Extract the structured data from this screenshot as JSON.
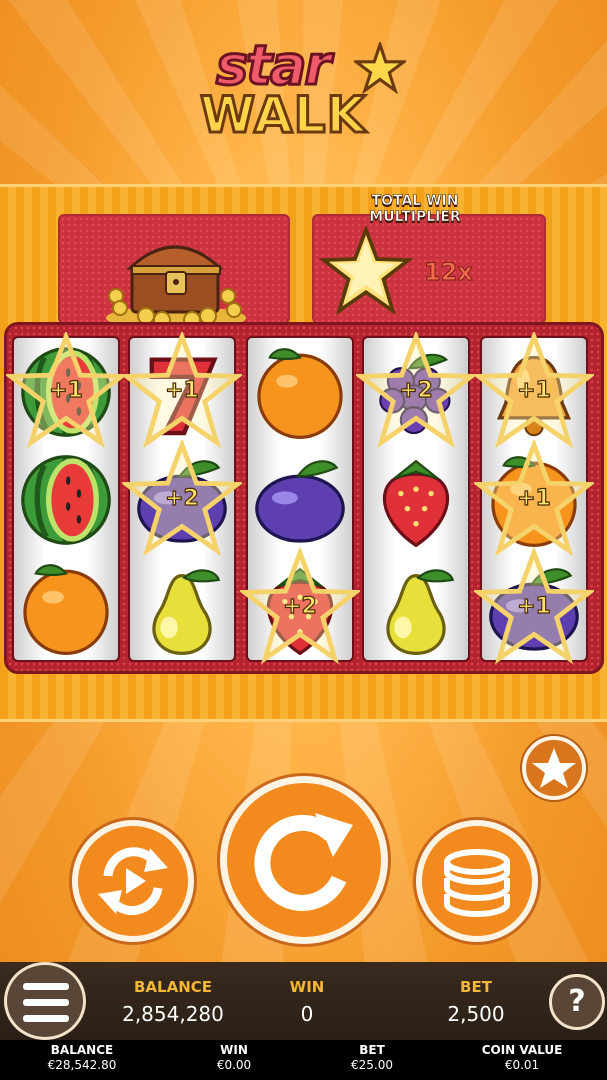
{
  "logo": {
    "line1": "star",
    "line2": "WALK"
  },
  "multiplier": {
    "label": "TOTAL WIN MULTIPLIER",
    "value": "12x"
  },
  "reels": [
    {
      "symbols": [
        "watermelon",
        "watermelon",
        "orange"
      ],
      "badges": [
        "+1",
        "",
        ""
      ]
    },
    {
      "symbols": [
        "seven",
        "plum",
        "pear"
      ],
      "badges": [
        "+1",
        "+2",
        ""
      ]
    },
    {
      "symbols": [
        "orange",
        "plum",
        "strawberry"
      ],
      "badges": [
        "",
        "",
        "+2"
      ]
    },
    {
      "symbols": [
        "grapes",
        "strawberry",
        "pear"
      ],
      "badges": [
        "+2",
        "",
        ""
      ]
    },
    {
      "symbols": [
        "bell",
        "orange",
        "plum"
      ],
      "badges": [
        "+1",
        "+1",
        "+1"
      ]
    }
  ],
  "controls": {
    "spin_icon": "spin-icon",
    "autoplay_icon": "autoplay-icon",
    "bet_icon": "coin-stack-icon",
    "favourite_icon": "star-icon",
    "menu_icon": "hamburger-icon",
    "help_label": "?"
  },
  "stats": {
    "balance_label": "BALANCE",
    "balance_value": "2,854,280",
    "win_label": "WIN",
    "win_value": "0",
    "bet_label": "BET",
    "bet_value": "2,500"
  },
  "footer": {
    "balance_label": "BALANCE",
    "balance_value": "€28,542.80",
    "win_label": "WIN",
    "win_value": "€0.00",
    "bet_label": "BET",
    "bet_value": "€25.00",
    "coin_label": "COIN VALUE",
    "coin_value": "€0.01"
  },
  "colors": {
    "accent": "#f28a1e",
    "panel": "#cc3340",
    "bar": "#2a1f16",
    "label": "#f2b638"
  }
}
